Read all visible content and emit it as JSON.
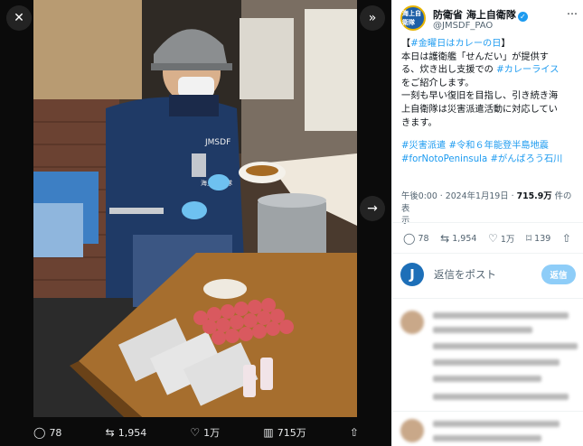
{
  "viewer": {
    "close_icon": "close-icon",
    "expand_icon": "expand-icon",
    "next_icon": "chevron-right-icon",
    "photo_vest_text": "JMSDF",
    "photo_vest_subtext": "海上自衛隊"
  },
  "media_actions": {
    "replies": "78",
    "reposts": "1,954",
    "likes": "1万",
    "views": "715万"
  },
  "author": {
    "name": "防衛省 海上自衛隊",
    "handle": "@JMSDF_PAO",
    "avatar_text": "海上自衛隊"
  },
  "post": {
    "l1_hashtag": "#金曜日はカレーの日",
    "l1_open": "【",
    "l1_close": "】",
    "l2": "本日は護衛艦「せんだい」が提供す",
    "l3_pre": "る、炊き出し支援での ",
    "l3_tag": "#カレーライス",
    "l4": "をご紹介します。",
    "l5": "一刻も早い復旧を目指し、引き続き海",
    "l6": "上自衛隊は災害派遣活動に対応してい",
    "l7": "きます。",
    "tags1_a": "#災害派遣",
    "tags1_b": " #令和６年能登半島地震",
    "tags2_a": "#forNotoPeninsula",
    "tags2_b": " #がんばろう石川"
  },
  "meta": {
    "time": "午後0:00 · 2024年1月19日 · ",
    "views": "715.9万",
    "views_suffix": " 件の表",
    "views_suffix2": "示"
  },
  "stats": {
    "replies": "78",
    "reposts": "1,954",
    "likes": "1万",
    "bookmarks": "139"
  },
  "reply": {
    "avatar_letter": "J",
    "placeholder": "返信をポスト",
    "button": "返信"
  }
}
